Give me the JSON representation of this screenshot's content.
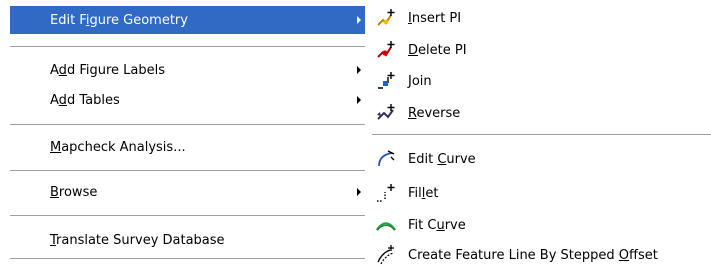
{
  "main_menu": {
    "items": [
      {
        "id": "edit-figure-geometry",
        "pre": "Edit F",
        "acc": "i",
        "post": "gure Geometry",
        "submenu": true,
        "highlighted": true
      },
      {
        "id": "add-figure-labels",
        "pre": "A",
        "acc": "d",
        "post": "d Figure Labels",
        "submenu": true
      },
      {
        "id": "add-tables",
        "pre": "A",
        "acc": "d",
        "post": "d Tables",
        "submenu": true
      },
      {
        "id": "mapcheck-analysis",
        "pre": "",
        "acc": "M",
        "post": "apcheck Analysis...",
        "submenu": false
      },
      {
        "id": "browse",
        "pre": "",
        "acc": "B",
        "post": "rowse",
        "submenu": true
      },
      {
        "id": "translate-survey-database",
        "pre": "",
        "acc": "T",
        "post": "ranslate Survey Database",
        "submenu": false
      }
    ]
  },
  "sub_menu": {
    "items": [
      {
        "id": "insert-pi",
        "icon": "insert-pi-icon",
        "pre": "",
        "acc": "I",
        "post": "nsert PI"
      },
      {
        "id": "delete-pi",
        "icon": "delete-pi-icon",
        "pre": "",
        "acc": "D",
        "post": "elete PI"
      },
      {
        "id": "join",
        "icon": "join-icon",
        "pre": "",
        "acc": "J",
        "post": "oin"
      },
      {
        "id": "reverse",
        "icon": "reverse-icon",
        "pre": "",
        "acc": "R",
        "post": "everse"
      },
      {
        "id": "edit-curve",
        "icon": "edit-curve-icon",
        "pre": "Edit ",
        "acc": "C",
        "post": "urve"
      },
      {
        "id": "fillet",
        "icon": "fillet-icon",
        "pre": "Fil",
        "acc": "l",
        "post": "et"
      },
      {
        "id": "fit-curve",
        "icon": "fit-curve-icon",
        "pre": "Fit C",
        "acc": "u",
        "post": "rve"
      },
      {
        "id": "create-feature-line",
        "icon": "stepped-offset-icon",
        "pre": "Create Feature Line By Stepped ",
        "acc": "O",
        "post": "ffset"
      }
    ]
  },
  "colors": {
    "highlight": "#316ac5",
    "highlight_text": "#ffffff",
    "separator": "#a0a0a0"
  }
}
